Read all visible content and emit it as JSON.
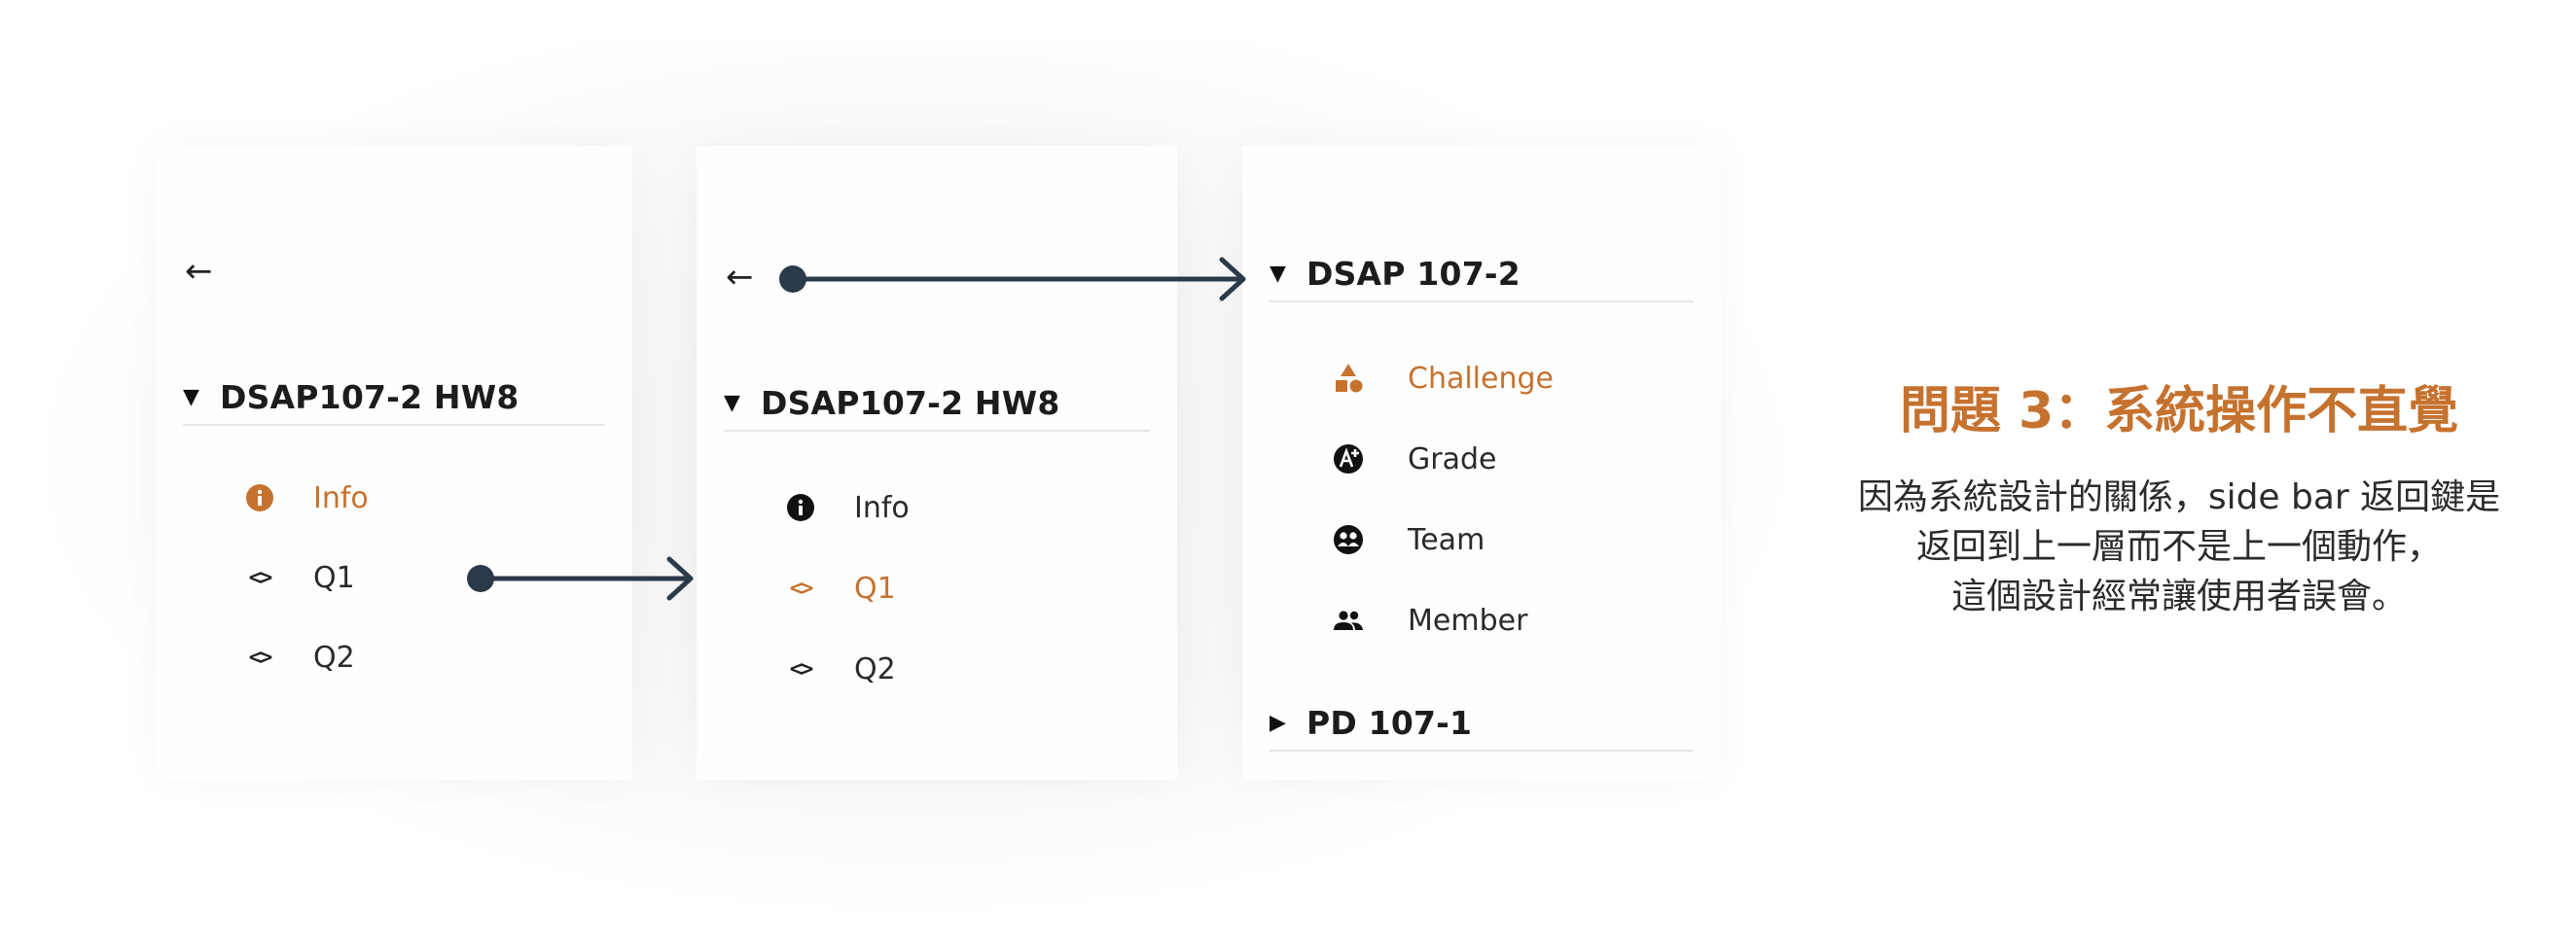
{
  "panel1": {
    "back_icon": "arrow-left-icon",
    "section_title": "DSAP107-2 HW8",
    "items": [
      {
        "label": "Info",
        "icon": "info-icon",
        "active": true
      },
      {
        "label": "Q1",
        "icon": "code-icon",
        "active": false
      },
      {
        "label": "Q2",
        "icon": "code-icon",
        "active": false
      }
    ]
  },
  "panel2": {
    "back_icon": "arrow-left-icon",
    "section_title": "DSAP107-2 HW8",
    "items": [
      {
        "label": "Info",
        "icon": "info-icon",
        "active": false
      },
      {
        "label": "Q1",
        "icon": "code-icon",
        "active": true
      },
      {
        "label": "Q2",
        "icon": "code-icon",
        "active": false
      }
    ]
  },
  "panel3": {
    "sections": [
      {
        "title": "DSAP 107-2",
        "expanded": true,
        "items": [
          {
            "label": "Challenge",
            "icon": "shapes-icon",
            "active": true
          },
          {
            "label": "Grade",
            "icon": "grade-icon",
            "active": false
          },
          {
            "label": "Team",
            "icon": "team-icon",
            "active": false
          },
          {
            "label": "Member",
            "icon": "people-icon",
            "active": false
          }
        ]
      },
      {
        "title": "PD 107-1",
        "expanded": false,
        "items": []
      }
    ]
  },
  "issue": {
    "title": "問題 3：系統操作不直覺",
    "lines": [
      "因為系統設計的關係，side bar 返回鍵是",
      "返回到上一層而不是上一個動作，",
      "這個設計經常讓使用者誤會。"
    ]
  },
  "colors": {
    "accent": "#c6722f",
    "connector": "#2b3a4a",
    "text": "#222222",
    "divider": "#e6e6e6"
  }
}
